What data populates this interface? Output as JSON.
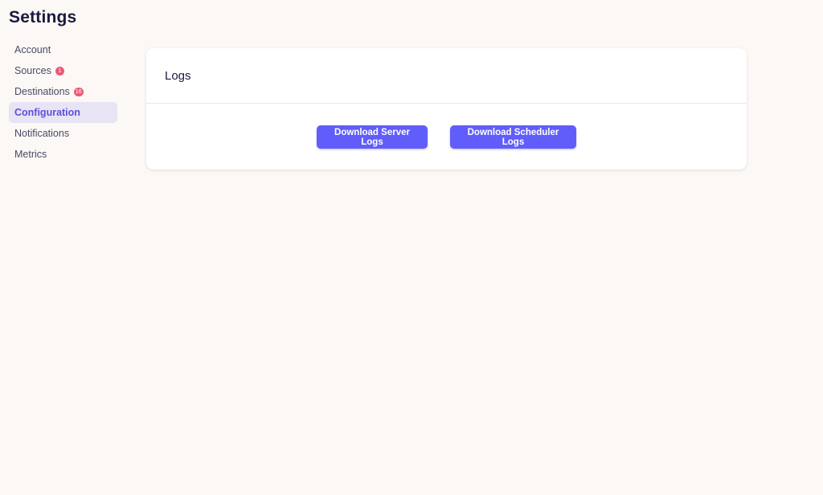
{
  "header": {
    "title": "Settings"
  },
  "sidebar": {
    "items": [
      {
        "label": "Account",
        "badge": null,
        "active": false
      },
      {
        "label": "Sources",
        "badge": "1",
        "active": false
      },
      {
        "label": "Destinations",
        "badge": "16",
        "active": false
      },
      {
        "label": "Configuration",
        "badge": null,
        "active": true
      },
      {
        "label": "Notifications",
        "badge": null,
        "active": false
      },
      {
        "label": "Metrics",
        "badge": null,
        "active": false
      }
    ]
  },
  "logs_card": {
    "title": "Logs",
    "download_server_label": "Download Server Logs",
    "download_scheduler_label": "Download Scheduler Logs"
  },
  "colors": {
    "background": "#fcf8f5",
    "accent": "#615dfa",
    "active_nav_bg": "#e8e4f5",
    "active_nav_text": "#5b4fd8",
    "badge": "#ec5a78"
  }
}
